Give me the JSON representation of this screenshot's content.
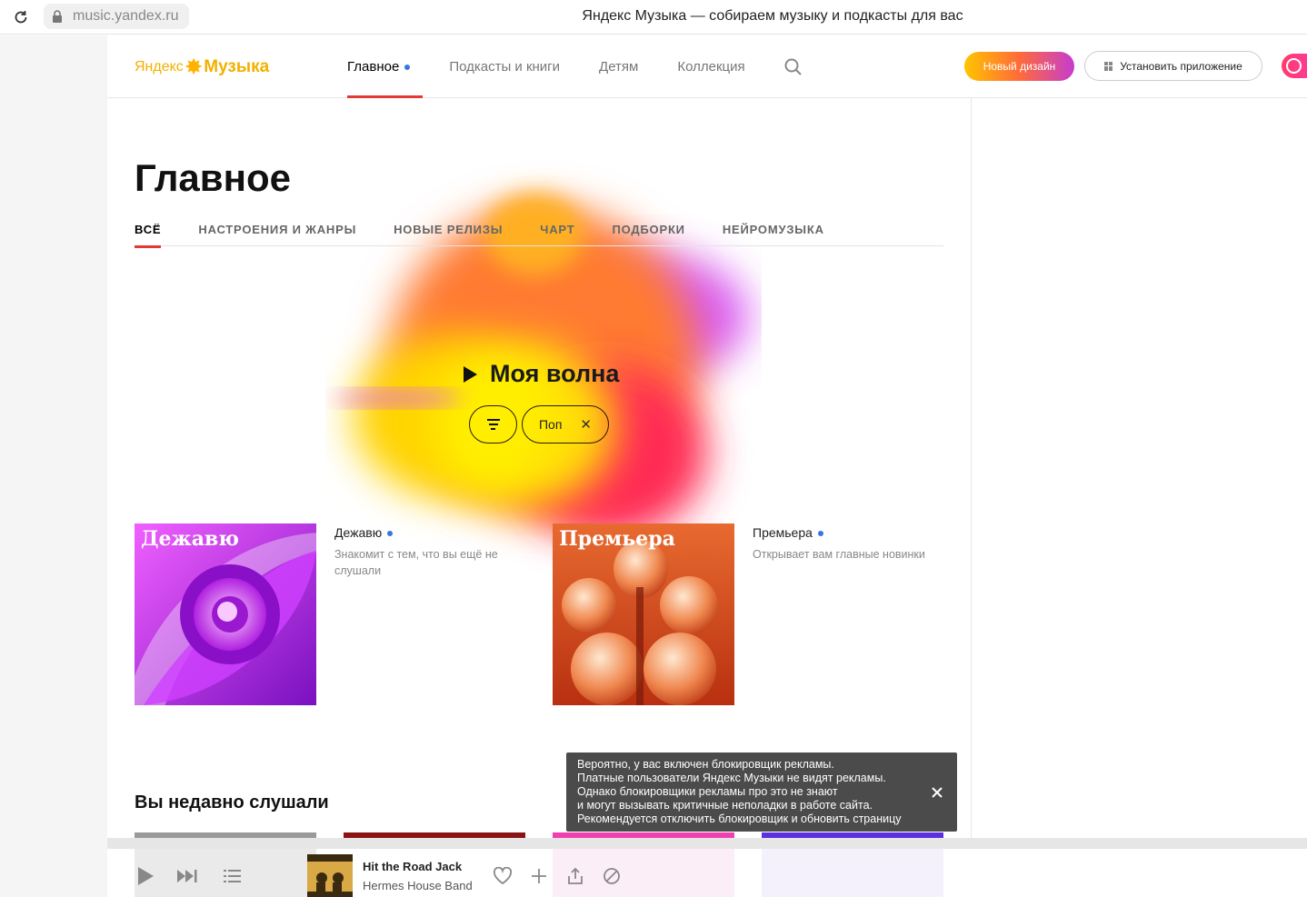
{
  "browser": {
    "url": "music.yandex.ru",
    "tab_title": "Яндекс Музыка — собираем музыку и подкасты для вас"
  },
  "header": {
    "logo_left": "Яндекс",
    "logo_right": "Музыка",
    "nav": [
      {
        "label": "Главное",
        "active": true
      },
      {
        "label": "Подкасты и книги",
        "active": false
      },
      {
        "label": "Детям",
        "active": false
      },
      {
        "label": "Коллекция",
        "active": false
      }
    ],
    "new_design_label": "Новый дизайн",
    "install_label": "Установить приложение"
  },
  "page": {
    "title": "Главное",
    "tabs": [
      "ВСЁ",
      "НАСТРОЕНИЯ И ЖАНРЫ",
      "НОВЫЕ РЕЛИЗЫ",
      "ЧАРТ",
      "ПОДБОРКИ",
      "НЕЙРОМУЗЫКА"
    ],
    "active_tab": "ВСЁ"
  },
  "wave": {
    "title": "Моя волна",
    "chip_label": "Поп"
  },
  "cards": [
    {
      "cover_title": "Дежавю",
      "name": "Дежавю",
      "description": "Знакомит с тем, что вы ещё не слушали"
    },
    {
      "cover_title": "Премьера",
      "name": "Премьера",
      "description": "Открывает вам главные новинки"
    }
  ],
  "recent": {
    "title": "Вы недавно слушали"
  },
  "ad_notice": {
    "lines": [
      "Вероятно, у вас включен блокировщик рекламы.",
      "Платные пользователи Яндекс Музыки не видят рекламы.",
      "Однако блокировщики рекламы про это не знают",
      "и могут вызывать критичные неполадки в работе сайта.",
      "Рекомендуется отключить блокировщик и обновить страницу"
    ]
  },
  "player": {
    "track_title": "Hit the Road Jack",
    "track_artist": "Hermes House Band"
  },
  "colors": {
    "accent_red": "#e53935",
    "dot_blue": "#3577e0",
    "logo_yellow": "#f2b000"
  }
}
